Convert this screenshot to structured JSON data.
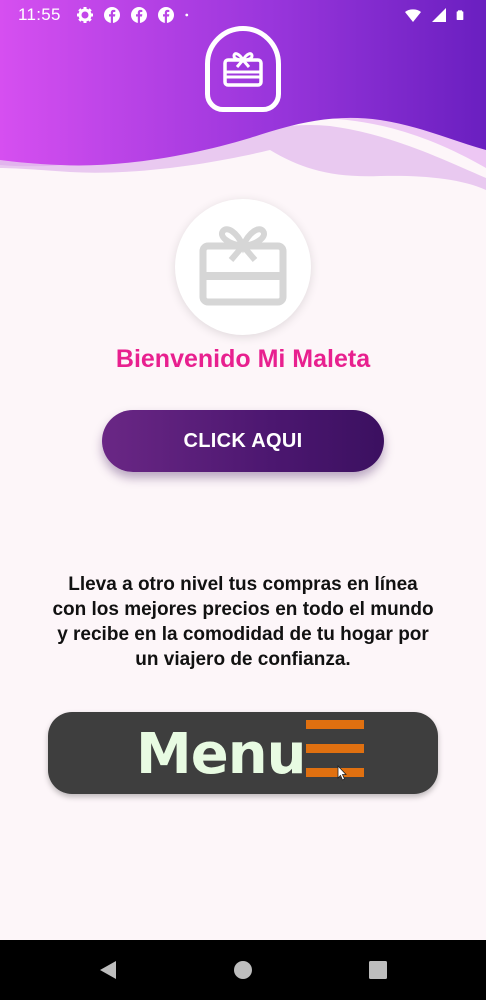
{
  "status_bar": {
    "time": "11:55",
    "left_icons": [
      "settings-icon",
      "facebook-icon",
      "facebook-icon",
      "facebook-icon",
      "dot-icon"
    ],
    "right_icons": [
      "wifi-icon",
      "signal-icon",
      "battery-icon"
    ]
  },
  "header": {
    "gradient_start": "#d64ff0",
    "gradient_end": "#6a1fc0",
    "logo_icon": "gift-card-icon"
  },
  "hero": {
    "icon": "gift-card-icon",
    "welcome_text": "Bienvenido Mi Maleta"
  },
  "cta_button": {
    "label": "CLICK AQUI"
  },
  "description": "Lleva a otro nivel tus compras en línea con los mejores precios en todo el mundo y recibe en la comodidad de tu hogar por un viajero de confianza.",
  "menu_button": {
    "label": "Menu",
    "icon": "hamburger-icon",
    "icon_color": "#e07010"
  },
  "colors": {
    "accent_pink": "#e8208f",
    "button_purple": "#5a1c7a",
    "menu_bg": "#3e3e3e"
  },
  "nav_bar": {
    "items": [
      "back-icon",
      "home-icon",
      "recents-icon"
    ]
  }
}
